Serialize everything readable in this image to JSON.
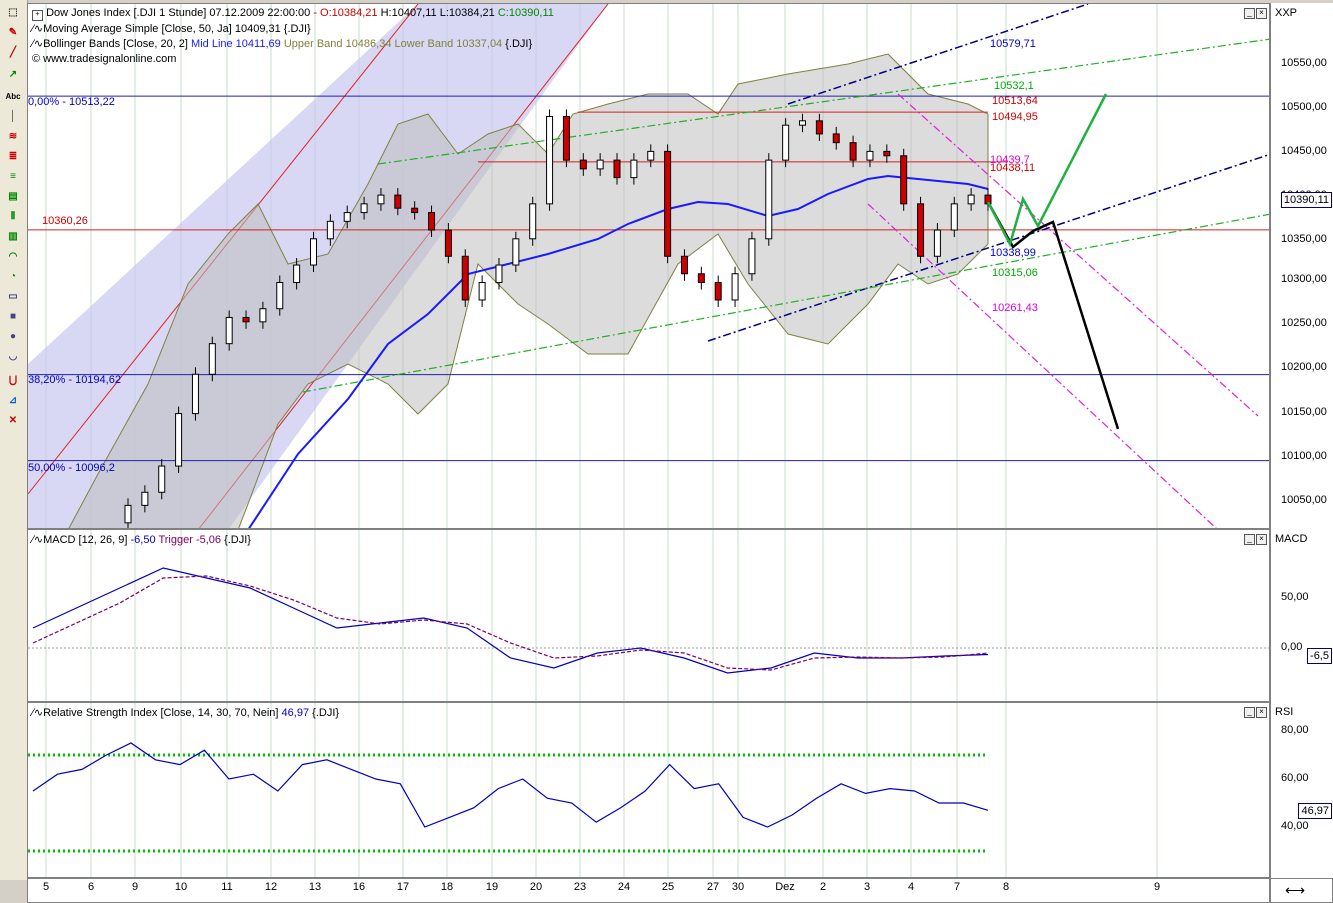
{
  "header": {
    "instrument": "Dow Jones Index [.DJI  1 Stunde] 07.12.2009 22:00:00",
    "ohlc_open": "- O:10384,21",
    "ohlc_hlc": "H:10407,11 L:10384,21",
    "ohlc_close": "C:10390,11",
    "sma": "Moving Average Simple [Close, 50, Ja] 10409,31 {.DJI}",
    "bb_name": "Bollinger Bands [Close, 20, 2]",
    "bb_mid": "Mid Line 10411,69",
    "bb_up": "Upper Band 10486,34",
    "bb_low": "Lower Band 10337,04",
    "bb_tail": "{.DJI}",
    "source": "© www.tradesignalonline.com"
  },
  "price_axis": {
    "title": "XXP",
    "ticks": [
      "10550,00",
      "10500,00",
      "10450,00",
      "10400,00",
      "10350,00",
      "10300,00",
      "10250,00",
      "10200,00",
      "10150,00",
      "10100,00",
      "10050,00"
    ],
    "current": "10390,11"
  },
  "fib": {
    "f0": "0,00% - 10513,22",
    "f382": "38,20% - 10194,62",
    "f50": "50,00% - 10096,2",
    "support": "10360,26"
  },
  "annotations": {
    "a1": "10579,71",
    "a2": "10532,1",
    "a3": "10513,64",
    "a4": "10494,95",
    "a5": "10439,7",
    "a6": "10438,11",
    "a7": "10338,99",
    "a8": "10315,06",
    "a9": "10261,43"
  },
  "macd": {
    "label": "MACD [12, 26, 9]",
    "value": "-6,50",
    "trigger_label": "Trigger",
    "trigger": "-5,06",
    "tail": "{.DJI}",
    "axis_title": "MACD",
    "ticks": [
      "50,00",
      "0,00"
    ],
    "current": "-6,5"
  },
  "rsi": {
    "label": "Relative Strength Index [Close, 14, 30, 70, Nein]",
    "value": "46,97",
    "tail": "{.DJI}",
    "axis_title": "RSI",
    "ticks": [
      "80,00",
      "60,00",
      "40,00"
    ],
    "current": "46,97"
  },
  "xaxis": [
    "5",
    "6",
    "9",
    "10",
    "11",
    "12",
    "13",
    "16",
    "17",
    "18",
    "19",
    "20",
    "23",
    "24",
    "25",
    "27",
    "30",
    "Dez",
    "2",
    "3",
    "4",
    "7",
    "8",
    "9"
  ],
  "colors": {
    "bull": "#ffffff",
    "bear": "#cc0000",
    "sma": "#1a1aff",
    "bb": "#808040",
    "macd": "#0000c0",
    "trigger": "#800060",
    "rsi": "#0000c0",
    "levels": "#00c000"
  },
  "chart_data": [
    {
      "type": "line",
      "title": "Dow Jones Index [.DJI 1 Stunde]",
      "ylim": [
        10000,
        10580
      ],
      "y_ticks": [
        10050,
        10100,
        10150,
        10200,
        10250,
        10300,
        10350,
        10400,
        10450,
        10500,
        10550
      ],
      "close_approx": [
        10045,
        10060,
        10090,
        10150,
        10195,
        10230,
        10260,
        10255,
        10270,
        10300,
        10320,
        10350,
        10370,
        10380,
        10390,
        10400,
        10385,
        10380,
        10360,
        10330,
        10280,
        10300,
        10320,
        10350,
        10390,
        10490,
        10440,
        10430,
        10440,
        10420,
        10440,
        10450,
        10330,
        10310,
        10300,
        10280,
        10310,
        10350,
        10440,
        10480,
        10485,
        10470,
        10460,
        10440,
        10450,
        10445,
        10390,
        10330,
        10360,
        10390,
        10400,
        10390
      ],
      "horizontal_levels": [
        10513.22,
        10194.62,
        10096.2,
        10360.26
      ]
    },
    {
      "type": "line",
      "title": "MACD [12, 26, 9]",
      "series": [
        {
          "name": "MACD",
          "values": [
            20,
            40,
            60,
            80,
            70,
            60,
            40,
            20,
            25,
            30,
            20,
            -10,
            -20,
            -5,
            0,
            -10,
            -25,
            -20,
            -5,
            -10,
            -10,
            -8,
            -6.5
          ]
        },
        {
          "name": "Trigger",
          "values": [
            5,
            25,
            45,
            70,
            72,
            62,
            48,
            30,
            24,
            28,
            24,
            5,
            -10,
            -8,
            -2,
            -5,
            -20,
            -22,
            -10,
            -9,
            -10,
            -9,
            -5.06
          ]
        }
      ]
    },
    {
      "type": "line",
      "title": "Relative Strength Index [Close, 14, 30, 70, Nein]",
      "ylim": [
        20,
        90
      ],
      "series": [
        {
          "name": "RSI",
          "values": [
            55,
            62,
            64,
            70,
            75,
            68,
            66,
            72,
            60,
            62,
            55,
            66,
            68,
            64,
            60,
            58,
            40,
            44,
            48,
            56,
            60,
            52,
            50,
            42,
            48,
            55,
            66,
            56,
            58,
            44,
            40,
            45,
            52,
            58,
            54,
            56,
            55,
            50,
            50,
            46.97
          ]
        }
      ],
      "levels": [
        30,
        70
      ]
    }
  ]
}
